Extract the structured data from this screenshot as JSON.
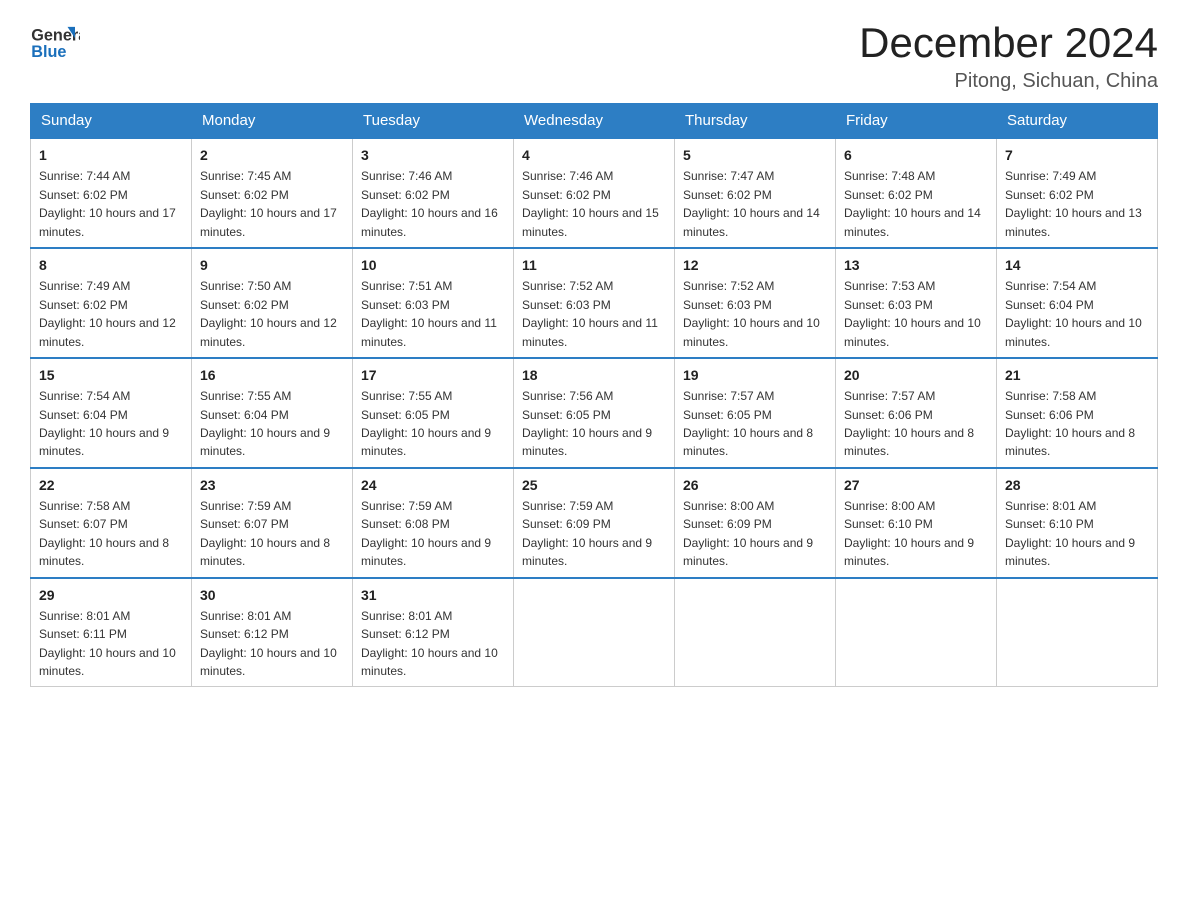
{
  "header": {
    "title": "December 2024",
    "location": "Pitong, Sichuan, China",
    "logo_general": "General",
    "logo_blue": "Blue"
  },
  "days_of_week": [
    "Sunday",
    "Monday",
    "Tuesday",
    "Wednesday",
    "Thursday",
    "Friday",
    "Saturday"
  ],
  "weeks": [
    [
      {
        "day": "1",
        "sunrise": "7:44 AM",
        "sunset": "6:02 PM",
        "daylight": "10 hours and 17 minutes."
      },
      {
        "day": "2",
        "sunrise": "7:45 AM",
        "sunset": "6:02 PM",
        "daylight": "10 hours and 17 minutes."
      },
      {
        "day": "3",
        "sunrise": "7:46 AM",
        "sunset": "6:02 PM",
        "daylight": "10 hours and 16 minutes."
      },
      {
        "day": "4",
        "sunrise": "7:46 AM",
        "sunset": "6:02 PM",
        "daylight": "10 hours and 15 minutes."
      },
      {
        "day": "5",
        "sunrise": "7:47 AM",
        "sunset": "6:02 PM",
        "daylight": "10 hours and 14 minutes."
      },
      {
        "day": "6",
        "sunrise": "7:48 AM",
        "sunset": "6:02 PM",
        "daylight": "10 hours and 14 minutes."
      },
      {
        "day": "7",
        "sunrise": "7:49 AM",
        "sunset": "6:02 PM",
        "daylight": "10 hours and 13 minutes."
      }
    ],
    [
      {
        "day": "8",
        "sunrise": "7:49 AM",
        "sunset": "6:02 PM",
        "daylight": "10 hours and 12 minutes."
      },
      {
        "day": "9",
        "sunrise": "7:50 AM",
        "sunset": "6:02 PM",
        "daylight": "10 hours and 12 minutes."
      },
      {
        "day": "10",
        "sunrise": "7:51 AM",
        "sunset": "6:03 PM",
        "daylight": "10 hours and 11 minutes."
      },
      {
        "day": "11",
        "sunrise": "7:52 AM",
        "sunset": "6:03 PM",
        "daylight": "10 hours and 11 minutes."
      },
      {
        "day": "12",
        "sunrise": "7:52 AM",
        "sunset": "6:03 PM",
        "daylight": "10 hours and 10 minutes."
      },
      {
        "day": "13",
        "sunrise": "7:53 AM",
        "sunset": "6:03 PM",
        "daylight": "10 hours and 10 minutes."
      },
      {
        "day": "14",
        "sunrise": "7:54 AM",
        "sunset": "6:04 PM",
        "daylight": "10 hours and 10 minutes."
      }
    ],
    [
      {
        "day": "15",
        "sunrise": "7:54 AM",
        "sunset": "6:04 PM",
        "daylight": "10 hours and 9 minutes."
      },
      {
        "day": "16",
        "sunrise": "7:55 AM",
        "sunset": "6:04 PM",
        "daylight": "10 hours and 9 minutes."
      },
      {
        "day": "17",
        "sunrise": "7:55 AM",
        "sunset": "6:05 PM",
        "daylight": "10 hours and 9 minutes."
      },
      {
        "day": "18",
        "sunrise": "7:56 AM",
        "sunset": "6:05 PM",
        "daylight": "10 hours and 9 minutes."
      },
      {
        "day": "19",
        "sunrise": "7:57 AM",
        "sunset": "6:05 PM",
        "daylight": "10 hours and 8 minutes."
      },
      {
        "day": "20",
        "sunrise": "7:57 AM",
        "sunset": "6:06 PM",
        "daylight": "10 hours and 8 minutes."
      },
      {
        "day": "21",
        "sunrise": "7:58 AM",
        "sunset": "6:06 PM",
        "daylight": "10 hours and 8 minutes."
      }
    ],
    [
      {
        "day": "22",
        "sunrise": "7:58 AM",
        "sunset": "6:07 PM",
        "daylight": "10 hours and 8 minutes."
      },
      {
        "day": "23",
        "sunrise": "7:59 AM",
        "sunset": "6:07 PM",
        "daylight": "10 hours and 8 minutes."
      },
      {
        "day": "24",
        "sunrise": "7:59 AM",
        "sunset": "6:08 PM",
        "daylight": "10 hours and 9 minutes."
      },
      {
        "day": "25",
        "sunrise": "7:59 AM",
        "sunset": "6:09 PM",
        "daylight": "10 hours and 9 minutes."
      },
      {
        "day": "26",
        "sunrise": "8:00 AM",
        "sunset": "6:09 PM",
        "daylight": "10 hours and 9 minutes."
      },
      {
        "day": "27",
        "sunrise": "8:00 AM",
        "sunset": "6:10 PM",
        "daylight": "10 hours and 9 minutes."
      },
      {
        "day": "28",
        "sunrise": "8:01 AM",
        "sunset": "6:10 PM",
        "daylight": "10 hours and 9 minutes."
      }
    ],
    [
      {
        "day": "29",
        "sunrise": "8:01 AM",
        "sunset": "6:11 PM",
        "daylight": "10 hours and 10 minutes."
      },
      {
        "day": "30",
        "sunrise": "8:01 AM",
        "sunset": "6:12 PM",
        "daylight": "10 hours and 10 minutes."
      },
      {
        "day": "31",
        "sunrise": "8:01 AM",
        "sunset": "6:12 PM",
        "daylight": "10 hours and 10 minutes."
      },
      null,
      null,
      null,
      null
    ]
  ]
}
